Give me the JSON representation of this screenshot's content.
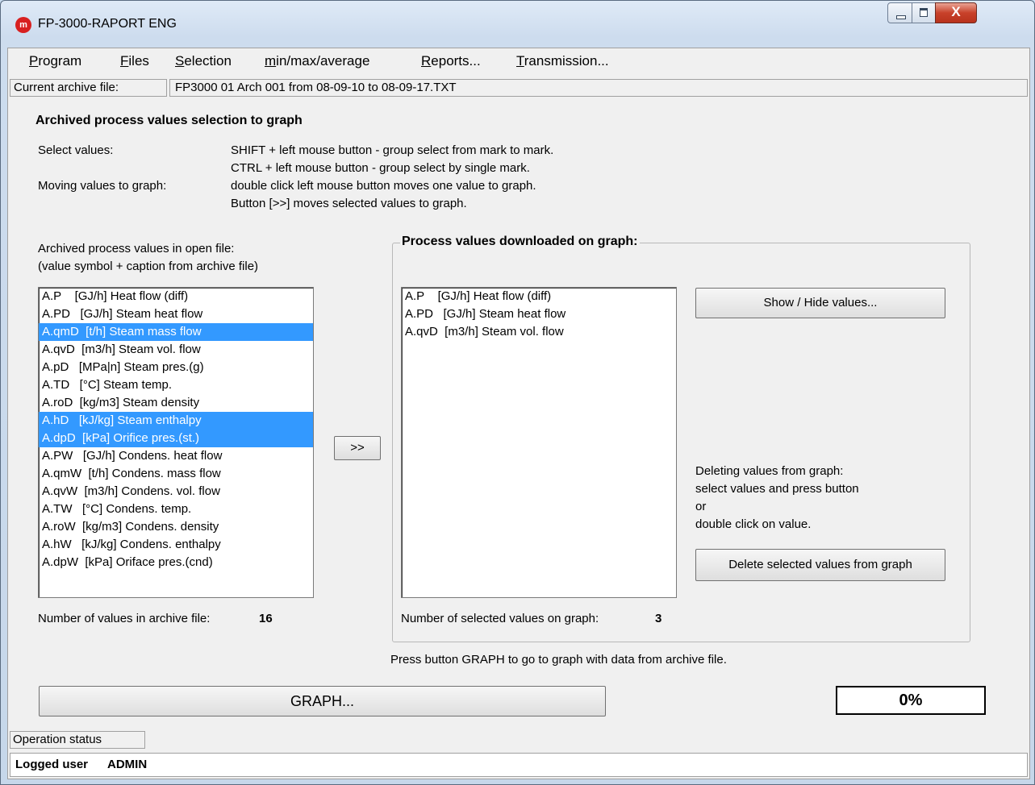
{
  "window": {
    "title": "FP-3000-RAPORT ENG",
    "app_icon_letter": "m",
    "close_glyph": "X"
  },
  "menu": {
    "items": [
      {
        "label": "Program",
        "mnemonic": "P",
        "rest": "rogram"
      },
      {
        "label": "Files",
        "mnemonic": "F",
        "rest": "iles"
      },
      {
        "label": "Selection",
        "mnemonic": "S",
        "rest": "election"
      },
      {
        "label": "min/max/average",
        "mnemonic": "m",
        "rest": "in/max/average"
      },
      {
        "label": "Reports...",
        "mnemonic": "R",
        "rest": "eports..."
      },
      {
        "label": "Transmission...",
        "mnemonic": "T",
        "rest": "ransmission..."
      }
    ]
  },
  "archive": {
    "label": "Current archive file:",
    "value": "FP3000 01 Arch 001 from 08-09-10 to 08-09-17.TXT"
  },
  "instructions": {
    "heading": "Archived process values selection to graph",
    "select_label": "Select values:",
    "select_line1": "SHIFT + left mouse button - group select from mark to mark.",
    "select_line2": "CTRL + left mouse button - group select by single mark.",
    "moving_label": "Moving values to graph:",
    "moving_line1": "double click left mouse button moves one value to graph.",
    "moving_line2": "Button [>>] moves selected values to graph."
  },
  "left_panel": {
    "caption1": "Archived process values in open file:",
    "caption2": "(value symbol + caption from archive file)",
    "items": [
      {
        "text": "A.P    [GJ/h] Heat flow (diff)",
        "selected": false
      },
      {
        "text": "A.PD   [GJ/h] Steam heat flow",
        "selected": false
      },
      {
        "text": "A.qmD  [t/h] Steam mass flow",
        "selected": true
      },
      {
        "text": "A.qvD  [m3/h] Steam vol. flow",
        "selected": false
      },
      {
        "text": "A.pD   [MPa|n] Steam pres.(g)",
        "selected": false
      },
      {
        "text": "A.TD   [°C] Steam temp.",
        "selected": false
      },
      {
        "text": "A.roD  [kg/m3] Steam density",
        "selected": false
      },
      {
        "text": "A.hD   [kJ/kg] Steam enthalpy",
        "selected": true
      },
      {
        "text": "A.dpD  [kPa] Orifice pres.(st.)",
        "selected": true
      },
      {
        "text": "A.PW   [GJ/h] Condens. heat flow",
        "selected": false
      },
      {
        "text": "A.qmW  [t/h] Condens. mass flow",
        "selected": false
      },
      {
        "text": "A.qvW  [m3/h] Condens. vol. flow",
        "selected": false
      },
      {
        "text": "A.TW   [°C] Condens. temp.",
        "selected": false
      },
      {
        "text": "A.roW  [kg/m3] Condens. density",
        "selected": false
      },
      {
        "text": "A.hW   [kJ/kg] Condens. enthalpy",
        "selected": false
      },
      {
        "text": "A.dpW  [kPa] Oriface pres.(cnd)",
        "selected": false
      }
    ],
    "count_label": "Number of values in archive file:",
    "count_value": "16"
  },
  "move_button": {
    "label": ">>"
  },
  "right_panel": {
    "title": "Process values downloaded on graph:",
    "items": [
      {
        "text": "A.P    [GJ/h] Heat flow (diff)"
      },
      {
        "text": "A.PD   [GJ/h] Steam heat flow"
      },
      {
        "text": "A.qvD  [m3/h] Steam vol. flow"
      }
    ],
    "show_hide_label": "Show / Hide values...",
    "delete_help1": "Deleting values from graph:",
    "delete_help2": "select values and press button",
    "delete_help3": "or",
    "delete_help4": "double click on value.",
    "delete_button_label": "Delete selected values from graph",
    "count_label": "Number of selected values on graph:",
    "count_value": "3"
  },
  "graph_hint": "Press button GRAPH to go to graph with data from archive file.",
  "graph_button": {
    "label": "GRAPH..."
  },
  "progress": {
    "text": "0%",
    "value": 0
  },
  "status": {
    "operation_label": "Operation status",
    "user_label": "Logged user",
    "user_value": "ADMIN"
  }
}
